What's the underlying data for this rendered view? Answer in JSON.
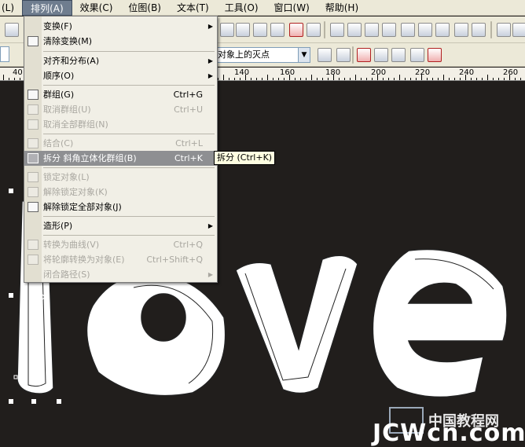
{
  "menubar": {
    "items": [
      {
        "label": "(L)"
      },
      {
        "label": "排列(A)"
      },
      {
        "label": "效果(C)"
      },
      {
        "label": "位图(B)"
      },
      {
        "label": "文本(T)"
      },
      {
        "label": "工具(O)"
      },
      {
        "label": "窗口(W)"
      },
      {
        "label": "帮助(H)"
      }
    ]
  },
  "toolbar": {
    "snap_combo": "对象上的灭点"
  },
  "ruler": {
    "labels": [
      "40",
      "140",
      "160",
      "180",
      "200",
      "220",
      "240",
      "260"
    ]
  },
  "menu": {
    "items": [
      {
        "label": "变换(F)",
        "shortcut": "",
        "submenu": true,
        "disabled": false
      },
      {
        "label": "清除变换(M)",
        "shortcut": "",
        "submenu": false,
        "disabled": false
      },
      {
        "label": "对齐和分布(A)",
        "shortcut": "",
        "submenu": true,
        "disabled": false
      },
      {
        "label": "顺序(O)",
        "shortcut": "",
        "submenu": true,
        "disabled": false
      },
      {
        "label": "群组(G)",
        "shortcut": "Ctrl+G",
        "submenu": false,
        "disabled": false
      },
      {
        "label": "取消群组(U)",
        "shortcut": "Ctrl+U",
        "submenu": false,
        "disabled": true
      },
      {
        "label": "取消全部群组(N)",
        "shortcut": "",
        "submenu": false,
        "disabled": true
      },
      {
        "label": "结合(C)",
        "shortcut": "Ctrl+L",
        "submenu": false,
        "disabled": true
      },
      {
        "label": "拆分 斜角立体化群组(B)",
        "shortcut": "Ctrl+K",
        "submenu": false,
        "disabled": false,
        "highlighted": true
      },
      {
        "label": "锁定对象(L)",
        "shortcut": "",
        "submenu": false,
        "disabled": true
      },
      {
        "label": "解除锁定对象(K)",
        "shortcut": "",
        "submenu": false,
        "disabled": true
      },
      {
        "label": "解除锁定全部对象(J)",
        "shortcut": "",
        "submenu": false,
        "disabled": false
      },
      {
        "label": "造形(P)",
        "shortcut": "",
        "submenu": true,
        "disabled": false
      },
      {
        "label": "转换为曲线(V)",
        "shortcut": "Ctrl+Q",
        "submenu": false,
        "disabled": true
      },
      {
        "label": "将轮廓转换为对象(E)",
        "shortcut": "Ctrl+Shift+Q",
        "submenu": false,
        "disabled": true
      },
      {
        "label": "闭合路径(S)",
        "shortcut": "",
        "submenu": true,
        "disabled": true
      }
    ]
  },
  "tooltip": "拆分 (Ctrl+K)",
  "watermark": {
    "cn": "中国教程网",
    "en": "JCWcn.com"
  },
  "colors": {
    "canvas_bg": "#211e1c",
    "menu_bg": "#f1efe6",
    "highlight": "#8e8f92"
  }
}
